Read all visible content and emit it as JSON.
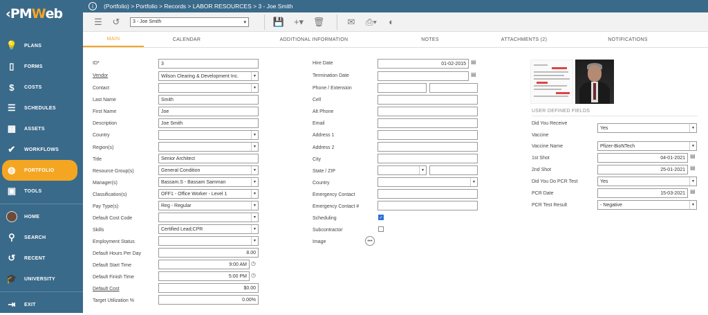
{
  "app": {
    "logo_prefix": "‹PM",
    "logo_w": "W",
    "logo_suffix": "eb"
  },
  "sidebar": {
    "items": [
      {
        "label": "PLANS",
        "icon": "lightbulb-icon"
      },
      {
        "label": "FORMS",
        "icon": "document-icon"
      },
      {
        "label": "COSTS",
        "icon": "dollar-icon"
      },
      {
        "label": "SCHEDULES",
        "icon": "schedule-icon"
      },
      {
        "label": "ASSETS",
        "icon": "building-icon"
      },
      {
        "label": "WORKFLOWS",
        "icon": "check-icon"
      },
      {
        "label": "PORTFOLIO",
        "icon": "globe-icon"
      },
      {
        "label": "TOOLS",
        "icon": "toolbox-icon"
      }
    ],
    "bottom": [
      {
        "label": "HOME",
        "icon": "avatar-icon"
      },
      {
        "label": "SEARCH",
        "icon": "search-icon"
      },
      {
        "label": "RECENT",
        "icon": "history-icon"
      },
      {
        "label": "UNIVERSITY",
        "icon": "graduation-icon"
      }
    ],
    "exit": "EXIT",
    "accent": "#f4a623",
    "bg": "#3a6a8a"
  },
  "breadcrumb": "(Portfolio) > Portfolio > Records > LABOR RESOURCES > 3 - Joe Smith",
  "toolbar": {
    "record_value": "3 - Joe Smith"
  },
  "tabs": [
    "MAIN",
    "CALENDAR",
    "ADDITIONAL INFORMATION",
    "NOTES",
    "ATTACHMENTS (2)",
    "NOTIFICATIONS"
  ],
  "left": {
    "id_label": "ID*",
    "id": "3",
    "vendor_label": "Vendor",
    "vendor": "Wilson Clearing & Development Inc.",
    "contact_label": "Contact",
    "contact": "",
    "last_name_label": "Last Name",
    "last_name": "Smith",
    "first_name_label": "First Name",
    "first_name": "Joe",
    "description_label": "Description",
    "description": "Joe Smith",
    "country_label": "Country",
    "country": "",
    "regions_label": "Region(s)",
    "regions": "",
    "title_label": "Title",
    "title": "Senior Architect",
    "resource_group_label": "Resource Group(s)",
    "resource_group": "General Condition",
    "managers_label": "Manager(s)",
    "managers": "Bassam.S - Bassam Samman",
    "classification_label": "Classification(s)",
    "classification": "OFF1 - Office Worker - Level 1",
    "pay_type_label": "Pay Type(s)",
    "pay_type": "Reg - Regular",
    "cost_code_label": "Default Cost Code",
    "cost_code": "",
    "skills_label": "Skills",
    "skills": "Certified Lead;CPR",
    "employment_label": "Employment Status",
    "employment": "",
    "hours_label": "Default Hours Per Day",
    "hours": "8.00",
    "start_label": "Default Start Time",
    "start": "9:00 AM",
    "finish_label": "Default Finish Time",
    "finish": "5:00 PM",
    "cost_label": "Default Cost",
    "cost": "$0.00",
    "util_label": "Target Utilization %",
    "util": "0.00%"
  },
  "middle": {
    "hire_label": "Hire Date",
    "hire": "01-02-2015",
    "term_label": "Termination Date",
    "term": "",
    "phone_label": "Phone / Extension",
    "cell_label": "Cell",
    "alt_phone_label": "Alt Phone",
    "email_label": "Email",
    "addr1_label": "Address 1",
    "addr2_label": "Address 2",
    "city_label": "City",
    "state_label": "State / ZIP",
    "country_label": "Country",
    "emerg_label": "Emergency Contact",
    "emerg_no_label": "Emergency Contact #",
    "scheduling_label": "Scheduling",
    "scheduling": true,
    "sub_label": "Subcontractor",
    "sub": false,
    "image_label": "Image"
  },
  "right": {
    "section_title": "USER DEFINED FIELDS",
    "vaccine_label_1": "Did You Receive",
    "vaccine_label_2": "Vaccine",
    "vaccine": "Yes",
    "vaccine_name_label": "Vaccine Name",
    "vaccine_name": "Pfizer-BioNTech",
    "shot1_label": "1st Shot",
    "shot1": "04-01-2021",
    "shot2_label": "2nd Shot",
    "shot2": "25-01-2021",
    "pcr_label": "Did You Do PCR Test",
    "pcr": "Yes",
    "pcr_date_label": "PCR Date",
    "pcr_date": "15-03-2021",
    "pcr_result_label": "PCR Test Result",
    "pcr_result": "- Negative"
  }
}
